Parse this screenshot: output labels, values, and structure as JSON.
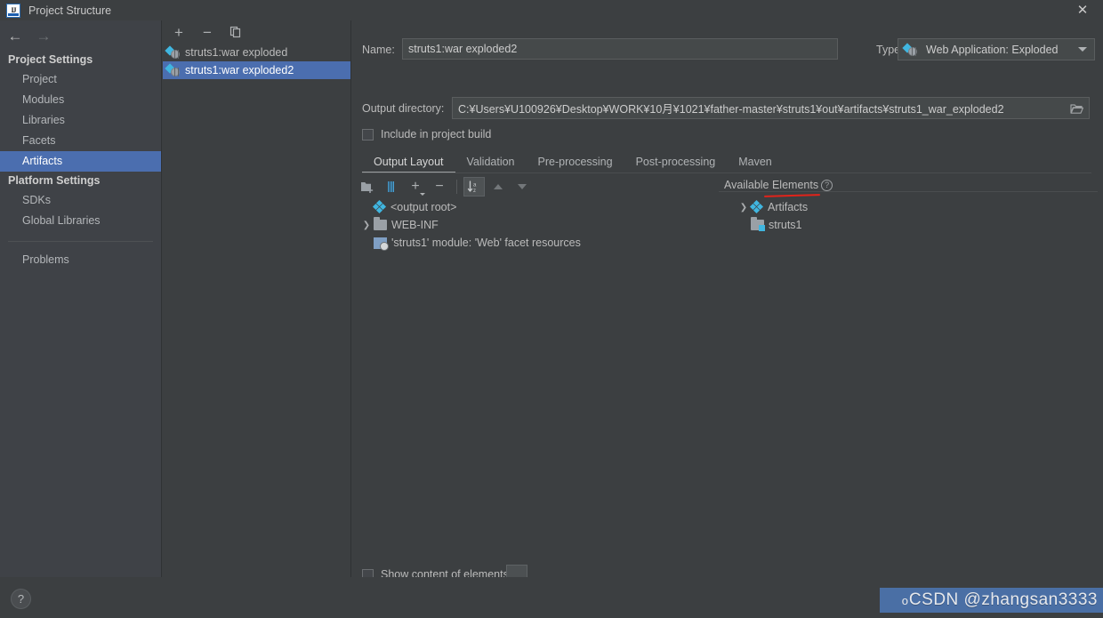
{
  "window": {
    "title": "Project Structure",
    "logo_icon": "intellij-idea-logo",
    "close_icon": "close-icon"
  },
  "navigation": {
    "back_icon": "arrow-left-icon",
    "forward_icon": "arrow-right-icon"
  },
  "sidebar": {
    "groups": [
      {
        "title": "Project Settings",
        "items": [
          {
            "label": "Project",
            "selected": false
          },
          {
            "label": "Modules",
            "selected": false
          },
          {
            "label": "Libraries",
            "selected": false
          },
          {
            "label": "Facets",
            "selected": false
          },
          {
            "label": "Artifacts",
            "selected": true
          }
        ]
      },
      {
        "title": "Platform Settings",
        "items": [
          {
            "label": "SDKs",
            "selected": false
          },
          {
            "label": "Global Libraries",
            "selected": false
          }
        ]
      }
    ],
    "problems_label": "Problems"
  },
  "artifact_list": {
    "toolbar": {
      "add_icon": "plus-icon",
      "remove_icon": "minus-icon",
      "copy_icon": "copy-icon"
    },
    "items": [
      {
        "label": "struts1:war exploded",
        "icon": "war-exploded-icon",
        "selected": false
      },
      {
        "label": "struts1:war exploded2",
        "icon": "war-exploded-icon",
        "selected": true
      }
    ]
  },
  "detail": {
    "name_label": "Name:",
    "name_value": "struts1:war exploded2",
    "type_label": "Type:",
    "type_value": "Web Application: Exploded",
    "type_icon": "war-exploded-icon",
    "type_arrow_icon": "chevron-down-icon",
    "output_dir_label": "Output directory:",
    "output_dir_value": "C:¥Users¥U100926¥Desktop¥WORK¥10月¥1021¥father-master¥struts1¥out¥artifacts¥struts1_war_exploded2",
    "browse_icon": "folder-open-icon",
    "include_in_build_label": "Include in project build",
    "include_in_build_checked": false,
    "tabs": [
      {
        "label": "Output Layout",
        "active": true
      },
      {
        "label": "Validation",
        "active": false
      },
      {
        "label": "Pre-processing",
        "active": false
      },
      {
        "label": "Post-processing",
        "active": false
      },
      {
        "label": "Maven",
        "active": false
      }
    ],
    "layout_toolbar": [
      {
        "name": "add-directory-icon",
        "state": "normal"
      },
      {
        "name": "add-archive-icon",
        "state": "normal"
      },
      {
        "name": "add-copy-icon",
        "state": "normal"
      },
      {
        "name": "remove-icon",
        "state": "normal"
      },
      {
        "name": "sort-alphabetically-icon",
        "state": "pressed"
      },
      {
        "name": "move-up-icon",
        "state": "disabled"
      },
      {
        "name": "move-down-icon",
        "state": "disabled"
      }
    ],
    "output_tree": [
      {
        "label": "<output root>",
        "icon": "artifact-icon",
        "indent": 0,
        "expandable": false
      },
      {
        "label": "WEB-INF",
        "icon": "folder-icon",
        "indent": 0,
        "expandable": true
      },
      {
        "label": "'struts1' module: 'Web' facet resources",
        "icon": "facet-resources-icon",
        "indent": 1,
        "expandable": false
      }
    ],
    "available_elements": {
      "title": "Available Elements",
      "help_icon": "help-icon",
      "items": [
        {
          "label": "Artifacts",
          "icon": "artifact-icon",
          "expandable": true,
          "annotated": true
        },
        {
          "label": "struts1",
          "icon": "module-icon",
          "expandable": false,
          "annotated": false
        }
      ]
    },
    "show_content_label": "Show content of elements",
    "show_content_checked": false,
    "ellipsis_label": "..."
  },
  "footer": {
    "help_label": "?"
  },
  "watermark": {
    "prefix": "o",
    "text": "CSDN @zhangsan3333",
    "color": "#4a6fa5"
  },
  "colors": {
    "background": "#3c3f41",
    "sidebar_background": "#3f4247",
    "selection": "#4b6eaf",
    "field_background": "#45494a",
    "text": "#bbbbbb",
    "annotation_red": "#e2231a",
    "accent_blue": "#40b6e0"
  }
}
